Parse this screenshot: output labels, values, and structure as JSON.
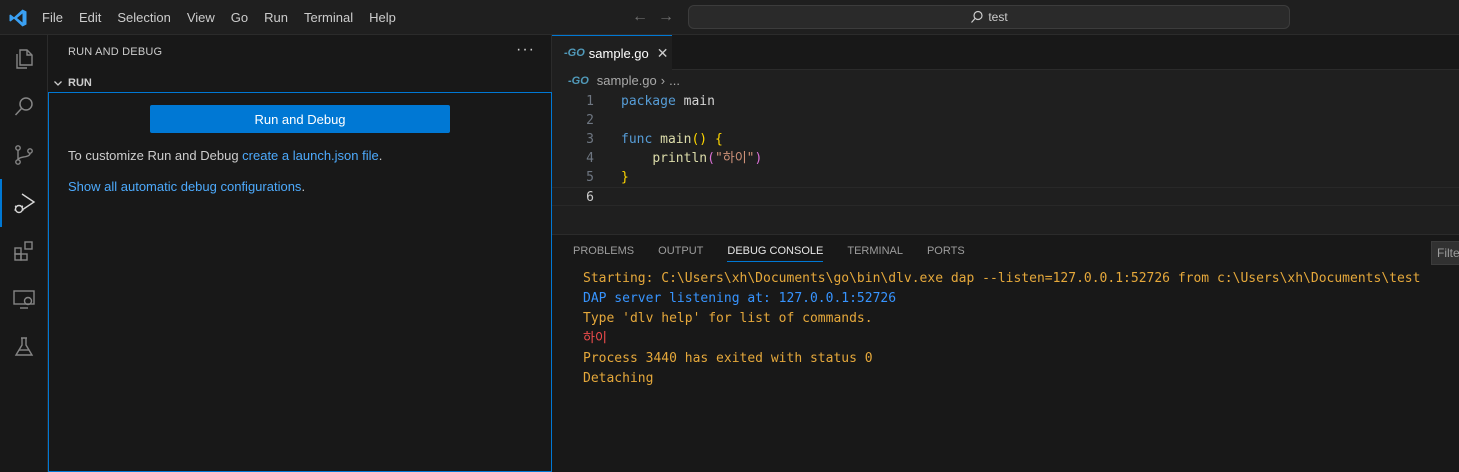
{
  "menu": [
    "File",
    "Edit",
    "Selection",
    "View",
    "Go",
    "Run",
    "Terminal",
    "Help"
  ],
  "search": {
    "text": "test"
  },
  "sidebar": {
    "title": "RUN AND DEBUG",
    "more": "···",
    "section": "RUN",
    "run_button": "Run and Debug",
    "hint_prefix": "To customize Run and Debug ",
    "hint_link": "create a launch.json file",
    "hint_suffix": ".",
    "show_all_link": "Show all automatic debug configurations",
    "show_all_suffix": "."
  },
  "editor": {
    "tab_label": "sample.go",
    "tab_icon": "go-icon",
    "breadcrumb_file": "sample.go",
    "breadcrumb_more": "...",
    "lines": [
      {
        "n": "1"
      },
      {
        "n": "2"
      },
      {
        "n": "3"
      },
      {
        "n": "4"
      },
      {
        "n": "5"
      },
      {
        "n": "6"
      }
    ],
    "code": {
      "package_kw": "package",
      "package_name": "main",
      "func_kw": "func",
      "func_name": "main",
      "call_name": "println",
      "string_val": "\"하이\""
    }
  },
  "panel": {
    "tabs": [
      "PROBLEMS",
      "OUTPUT",
      "DEBUG CONSOLE",
      "TERMINAL",
      "PORTS"
    ],
    "active_tab": "DEBUG CONSOLE",
    "filter": "Filter",
    "console": [
      {
        "text": "Starting: C:\\Users\\xh\\Documents\\go\\bin\\dlv.exe dap --listen=127.0.0.1:52726 from c:\\Users\\xh\\Documents\\test",
        "color": "#e5a83b"
      },
      {
        "text": "DAP server listening at: 127.0.0.1:52726",
        "color": "#3794ff"
      },
      {
        "text": "Type 'dlv help' for list of commands.",
        "color": "#e5a83b"
      },
      {
        "text": "하이",
        "color": "#f14c4c"
      },
      {
        "text": "Process 3440 has exited with status 0",
        "color": "#e5a83b"
      },
      {
        "text": "Detaching",
        "color": "#e5a83b"
      }
    ]
  },
  "colors": {
    "accent": "#0078d4",
    "link": "#4daafc"
  }
}
